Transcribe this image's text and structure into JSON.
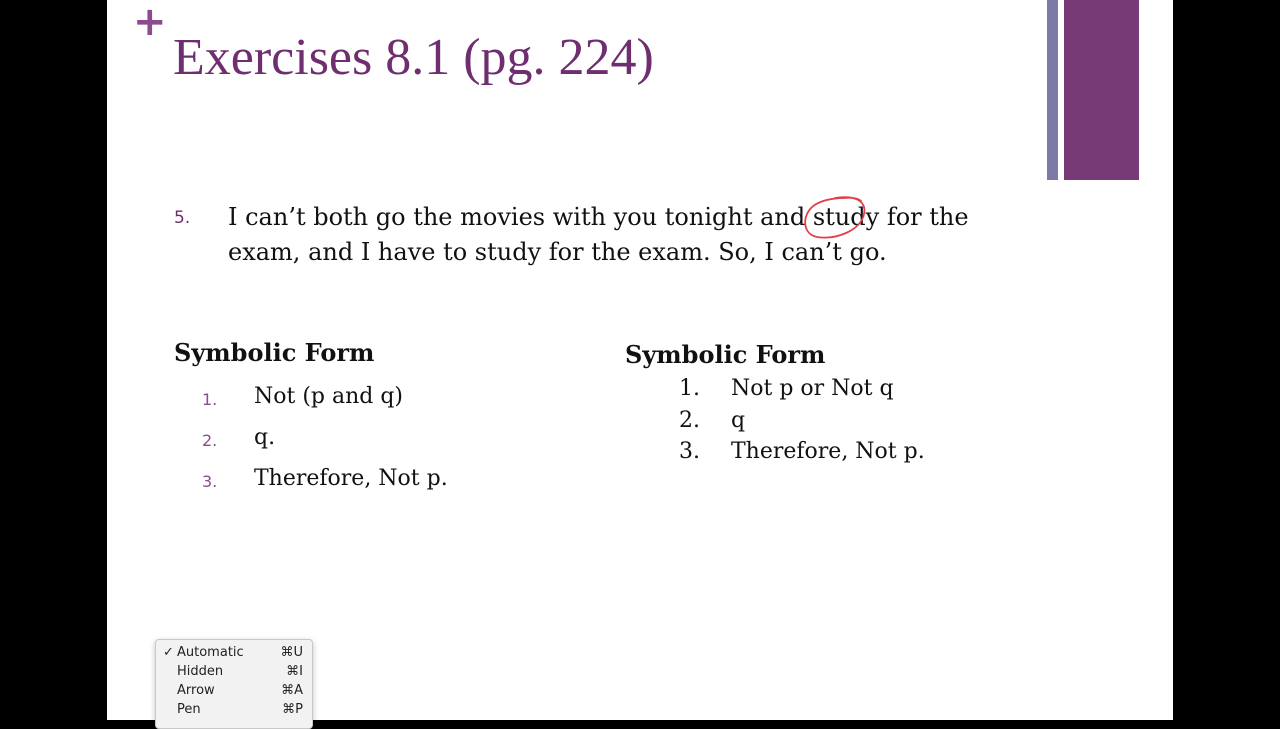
{
  "colors": {
    "accent_purple": "#6e2e6f",
    "number_purple": "#8d4a8f",
    "thin_bar": "#7b7aa8",
    "wide_bar": "#773a76",
    "ink_red": "#e0404a",
    "text": "#111111"
  },
  "slide": {
    "plus_icon": "+",
    "title": "Exercises 8.1 (pg. 224)"
  },
  "problem": {
    "number": "5.",
    "text": "I can’t both go the movies with you tonight and study for the exam, and I have to study for the exam. So, I can’t go."
  },
  "left_column": {
    "heading": "Symbolic Form",
    "steps": [
      {
        "num": "1.",
        "text": "Not (p and q)"
      },
      {
        "num": "2.",
        "text": "q."
      },
      {
        "num": "3.",
        "text": "Therefore, Not p."
      }
    ]
  },
  "right_column": {
    "heading": "Symbolic Form",
    "steps": [
      {
        "num": "1.",
        "text": "Not p or Not q"
      },
      {
        "num": "2.",
        "text": "q"
      },
      {
        "num": "3.",
        "text": "Therefore, Not p."
      }
    ]
  },
  "pointer_menu": {
    "items": [
      {
        "checked": true,
        "check": "✓",
        "label": "Automatic",
        "shortcut": "⌘U"
      },
      {
        "checked": false,
        "check": "",
        "label": "Hidden",
        "shortcut": "⌘I"
      },
      {
        "checked": false,
        "check": "",
        "label": "Arrow",
        "shortcut": "⌘A"
      },
      {
        "checked": false,
        "check": "",
        "label": "Pen",
        "shortcut": "⌘P"
      }
    ]
  }
}
